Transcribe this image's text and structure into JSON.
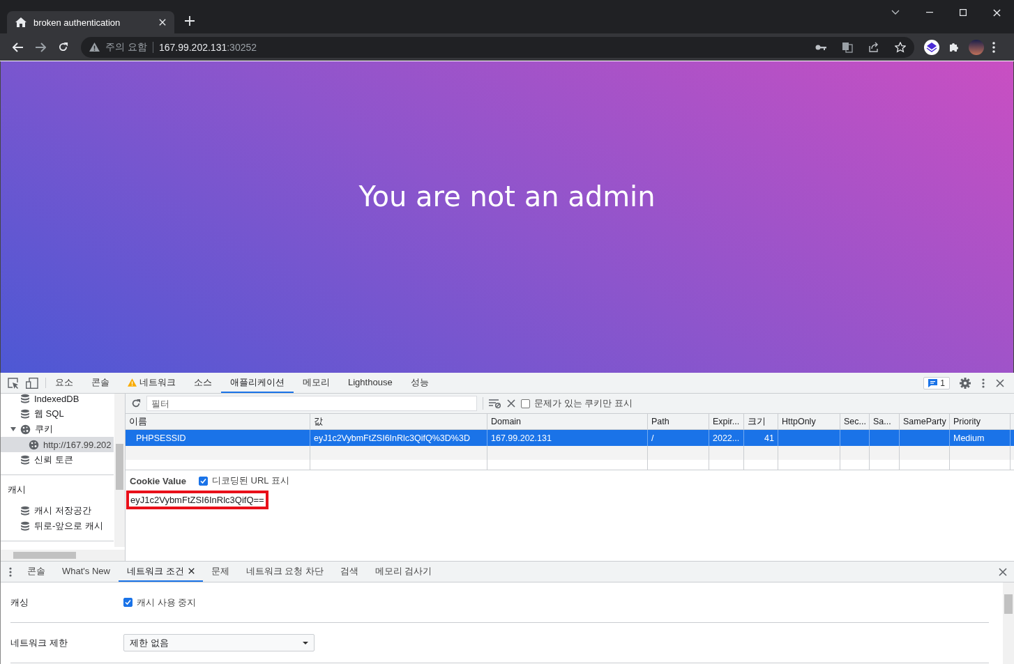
{
  "browser": {
    "tab": {
      "title": "broken authentication"
    },
    "address": {
      "security_label": "주의 요함",
      "host": "167.99.202.131",
      "port": ":30252"
    }
  },
  "page": {
    "heading": "You are not an admin"
  },
  "devtools": {
    "tabs": [
      {
        "label": "요소",
        "selected": false,
        "warning": false
      },
      {
        "label": "콘솔",
        "selected": false,
        "warning": false
      },
      {
        "label": "네트워크",
        "selected": false,
        "warning": true
      },
      {
        "label": "소스",
        "selected": false,
        "warning": false
      },
      {
        "label": "애플리케이션",
        "selected": true,
        "warning": false
      },
      {
        "label": "메모리",
        "selected": false,
        "warning": false
      },
      {
        "label": "Lighthouse",
        "selected": false,
        "warning": false
      },
      {
        "label": "성능",
        "selected": false,
        "warning": false
      }
    ],
    "issues_count": "1",
    "sidebar": {
      "tree": [
        {
          "label": "IndexedDB",
          "kind": "database",
          "selected": false
        },
        {
          "label": "웹 SQL",
          "kind": "database",
          "selected": false
        },
        {
          "label": "쿠키",
          "kind": "cookie",
          "selected": false,
          "expanded": true,
          "children": [
            {
              "label": "http://167.99.202",
              "kind": "cookie",
              "selected": true
            }
          ]
        },
        {
          "label": "신뢰 토큰",
          "kind": "database",
          "selected": false
        }
      ],
      "cache": {
        "title": "캐시",
        "items": [
          {
            "label": "캐시 저장공간",
            "kind": "database",
            "selected": false
          },
          {
            "label": "뒤로-앞으로 캐시",
            "kind": "database",
            "selected": false
          }
        ]
      }
    },
    "cookies": {
      "filter": {
        "placeholder": "필터"
      },
      "only_issues": {
        "label": "문제가 있는 쿠키만 표시",
        "checked": false
      },
      "columns": [
        "이름",
        "값",
        "Domain",
        "Path",
        "Expir...",
        "크기",
        "HttpOnly",
        "Sec...",
        "Sa...",
        "SameParty",
        "Priority"
      ],
      "rows": [
        {
          "selected": true,
          "name": "PHPSESSID",
          "value": "eyJ1c2VybmFtZSI6InRlc3QifQ%3D%3D",
          "domain": "167.99.202.131",
          "path": "/",
          "expires": "2022...",
          "size": "41",
          "priority": "Medium"
        }
      ],
      "value_panel": {
        "title": "Cookie Value",
        "decode": {
          "label": "디코딩된 URL 표시",
          "checked": true
        },
        "value": "eyJ1c2VybmFtZSI6InRlc3QifQ==",
        "highlighted": true
      }
    },
    "drawer": {
      "tabs": [
        {
          "label": "콘솔",
          "selected": false
        },
        {
          "label": "What's New",
          "selected": false
        },
        {
          "label": "네트워크 조건",
          "selected": true
        },
        {
          "label": "문제",
          "selected": false
        },
        {
          "label": "네트워크 요청 차단",
          "selected": false
        },
        {
          "label": "검색",
          "selected": false
        },
        {
          "label": "메모리 검사기",
          "selected": false
        }
      ],
      "caching": {
        "label": "캐싱",
        "checkbox": {
          "label": "캐시 사용 중지",
          "checked": true
        }
      },
      "throttling": {
        "label": "네트워크 제한",
        "value": "제한 없음"
      }
    }
  }
}
